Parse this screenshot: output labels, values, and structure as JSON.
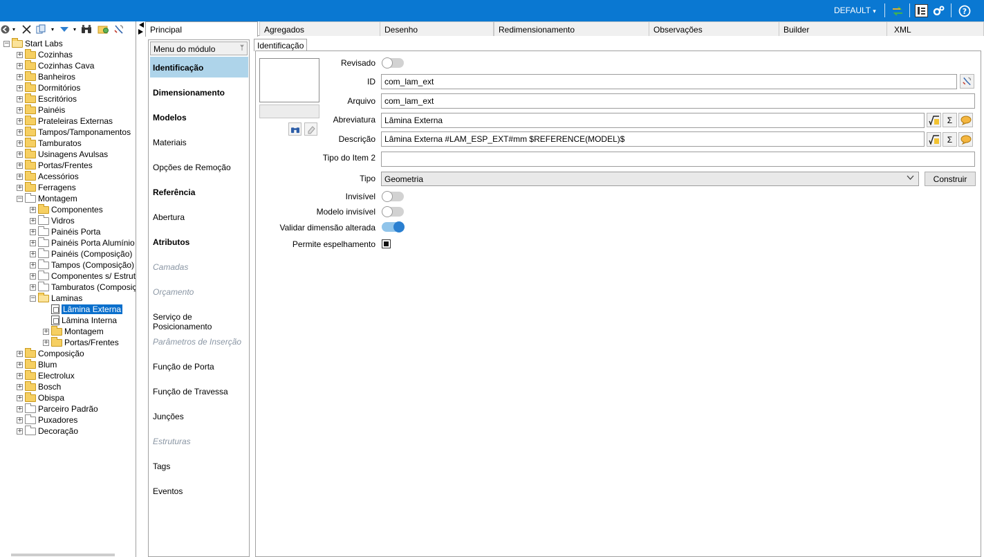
{
  "topbar": {
    "profile": "DEFAULT",
    "profile_caret": "▾",
    "icons": [
      "exchange-icon",
      "list-icon",
      "settings-icon",
      "help-icon"
    ]
  },
  "left_toolbar": {
    "icons": [
      "back-icon",
      "close-icon",
      "copy-icon",
      "down-arrow-icon",
      "binoculars-icon",
      "folder-refresh-icon",
      "tool-icon"
    ]
  },
  "tree": [
    {
      "label": "Start Labs",
      "level": 0,
      "exp": "−",
      "icon": "open"
    },
    {
      "label": "Cozinhas",
      "level": 1,
      "exp": "+",
      "icon": "folder"
    },
    {
      "label": "Cozinhas Cava",
      "level": 1,
      "exp": "+",
      "icon": "folder"
    },
    {
      "label": "Banheiros",
      "level": 1,
      "exp": "+",
      "icon": "folder"
    },
    {
      "label": "Dormitórios",
      "level": 1,
      "exp": "+",
      "icon": "folder"
    },
    {
      "label": "Escritórios",
      "level": 1,
      "exp": "+",
      "icon": "folder"
    },
    {
      "label": "Painéis",
      "level": 1,
      "exp": "+",
      "icon": "folder"
    },
    {
      "label": "Prateleiras Externas",
      "level": 1,
      "exp": "+",
      "icon": "folder"
    },
    {
      "label": "Tampos/Tamponamentos",
      "level": 1,
      "exp": "+",
      "icon": "folder"
    },
    {
      "label": "Tamburatos",
      "level": 1,
      "exp": "+",
      "icon": "folder"
    },
    {
      "label": "Usinagens Avulsas",
      "level": 1,
      "exp": "+",
      "icon": "folder"
    },
    {
      "label": "Portas/Frentes",
      "level": 1,
      "exp": "+",
      "icon": "folder"
    },
    {
      "label": "Acessórios",
      "level": 1,
      "exp": "+",
      "icon": "folder"
    },
    {
      "label": "Ferragens",
      "level": 1,
      "exp": "+",
      "icon": "folder"
    },
    {
      "label": "Montagem",
      "level": 1,
      "exp": "−",
      "icon": "grey"
    },
    {
      "label": "Componentes",
      "level": 2,
      "exp": "+",
      "icon": "folder"
    },
    {
      "label": "Vidros",
      "level": 2,
      "exp": "+",
      "icon": "grey"
    },
    {
      "label": "Painéis Porta",
      "level": 2,
      "exp": "+",
      "icon": "grey"
    },
    {
      "label": "Painéis Porta Alumínio",
      "level": 2,
      "exp": "+",
      "icon": "grey"
    },
    {
      "label": "Painéis (Composição)",
      "level": 2,
      "exp": "+",
      "icon": "grey"
    },
    {
      "label": "Tampos (Composição)",
      "level": 2,
      "exp": "+",
      "icon": "grey"
    },
    {
      "label": "Componentes s/ Estrutu",
      "level": 2,
      "exp": "+",
      "icon": "grey"
    },
    {
      "label": "Tamburatos (Composiç",
      "level": 2,
      "exp": "+",
      "icon": "grey"
    },
    {
      "label": "Laminas",
      "level": 2,
      "exp": "−",
      "icon": "open"
    },
    {
      "label": "Lâmina Externa",
      "level": 3,
      "exp": "",
      "icon": "doc",
      "selected": true
    },
    {
      "label": "Lâmina Interna",
      "level": 3,
      "exp": "",
      "icon": "doc"
    },
    {
      "label": "Montagem",
      "level": 3,
      "exp": "+",
      "icon": "folder",
      "shift": -1
    },
    {
      "label": "Portas/Frentes",
      "level": 3,
      "exp": "+",
      "icon": "folder",
      "shift": -1
    },
    {
      "label": "Composição",
      "level": 1,
      "exp": "+",
      "icon": "folder"
    },
    {
      "label": "Blum",
      "level": 1,
      "exp": "+",
      "icon": "folder"
    },
    {
      "label": "Electrolux",
      "level": 1,
      "exp": "+",
      "icon": "folder"
    },
    {
      "label": "Bosch",
      "level": 1,
      "exp": "+",
      "icon": "folder"
    },
    {
      "label": "Obispa",
      "level": 1,
      "exp": "+",
      "icon": "folder"
    },
    {
      "label": "Parceiro Padrão",
      "level": 1,
      "exp": "+",
      "icon": "grey"
    },
    {
      "label": "Puxadores",
      "level": 1,
      "exp": "+",
      "icon": "grey"
    },
    {
      "label": "Decoração",
      "level": 1,
      "exp": "+",
      "icon": "grey"
    }
  ],
  "tabs": [
    "Principal",
    "Agregados",
    "Desenho",
    "Redimensionamento",
    "Observações",
    "Builder",
    "XML"
  ],
  "module_menu": {
    "header": "Menu do módulo",
    "pin": "ᛘ",
    "items": [
      {
        "label": "Identificação",
        "style": "bold",
        "active": true
      },
      {
        "label": "Dimensionamento",
        "style": "bold"
      },
      {
        "label": "Modelos",
        "style": "bold"
      },
      {
        "label": "Materiais",
        "style": "normal"
      },
      {
        "label": "Opções de Remoção",
        "style": "normal"
      },
      {
        "label": "Referência",
        "style": "bold"
      },
      {
        "label": "Abertura",
        "style": "normal"
      },
      {
        "label": "Atributos",
        "style": "bold"
      },
      {
        "label": "Camadas",
        "style": "disabled"
      },
      {
        "label": "Orçamento",
        "style": "disabled"
      },
      {
        "label": "Serviço de Posicionamento",
        "style": "normal"
      },
      {
        "label": "Parâmetros de Inserção",
        "style": "disabled"
      },
      {
        "label": "Função de Porta",
        "style": "normal"
      },
      {
        "label": "Função de Travessa",
        "style": "normal"
      },
      {
        "label": "Junções",
        "style": "normal"
      },
      {
        "label": "Estruturas",
        "style": "disabled"
      },
      {
        "label": "Tags",
        "style": "normal"
      },
      {
        "label": "Eventos",
        "style": "normal"
      }
    ]
  },
  "form": {
    "subtab": "Identificação",
    "revisado_label": "Revisado",
    "revisado_on": false,
    "id_label": "ID",
    "id_value": "com_lam_ext",
    "arquivo_label": "Arquivo",
    "arquivo_value": "com_lam_ext",
    "abreviatura_label": "Abreviatura",
    "abreviatura_value": "Lâmina Externa",
    "descricao_label": "Descrição",
    "descricao_value": "Lâmina Externa #LAM_ESP_EXT#mm $REFERENCE(MODEL)$",
    "tipo_item2_label": "Tipo do Item 2",
    "tipo_item2_value": "",
    "tipo_label": "Tipo",
    "tipo_value": "Geometria",
    "construir_label": "Construir",
    "invisivel_label": "Invisível",
    "invisivel_on": false,
    "modelo_invisivel_label": "Modelo invisível",
    "modelo_invisivel_on": false,
    "validar_label": "Validar dimensão alterada",
    "validar_on": true,
    "espelhamento_label": "Permite espelhamento",
    "espelhamento_checked": true,
    "sigma": "Σ"
  },
  "colors": {
    "topbar": "#0a78d2",
    "selection": "#0a6fcc",
    "menu_active": "#aed4ea",
    "toggle_on": "#2a7fd0"
  }
}
